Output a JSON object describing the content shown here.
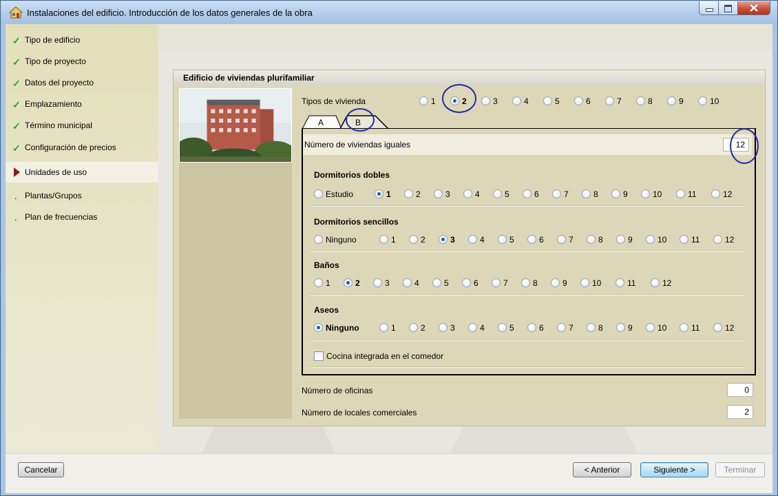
{
  "window": {
    "title": "Instalaciones del edificio. Introducción de los datos generales de la obra",
    "icon": "house-icon",
    "controls": [
      "minimize-icon",
      "maximize-icon",
      "close-icon"
    ]
  },
  "sidebar": {
    "items": [
      {
        "label": "Tipo de edificio",
        "state": "done"
      },
      {
        "label": "Tipo de proyecto",
        "state": "done"
      },
      {
        "label": "Datos del proyecto",
        "state": "done"
      },
      {
        "label": "Emplazamiento",
        "state": "done"
      },
      {
        "label": "Término municipal",
        "state": "done"
      },
      {
        "label": "Configuración de precios",
        "state": "done"
      },
      {
        "label": "Unidades de uso",
        "state": "current"
      },
      {
        "label": "Plantas/Grupos",
        "state": "pending"
      },
      {
        "label": "Plan de frecuencias",
        "state": "pending"
      }
    ]
  },
  "panel": {
    "title": "Edificio de viviendas plurifamiliar",
    "tipos_label": "Tipos de vivienda",
    "tipos_options": [
      "1",
      "2",
      "3",
      "4",
      "5",
      "6",
      "7",
      "8",
      "9",
      "10"
    ],
    "tipos_selected": "2",
    "tabs": [
      "A",
      "B"
    ],
    "active_tab": "B",
    "num_viviendas_label": "Número de viviendas iguales",
    "num_viviendas_value": "12",
    "dormitorios_dobles": {
      "title": "Dormitorios dobles",
      "options": [
        "Estudio",
        "1",
        "2",
        "3",
        "4",
        "5",
        "6",
        "7",
        "8",
        "9",
        "10",
        "11",
        "12"
      ],
      "selected": "1"
    },
    "dormitorios_sencillos": {
      "title": "Dormitorios sencillos",
      "options": [
        "Ninguno",
        "1",
        "2",
        "3",
        "4",
        "5",
        "6",
        "7",
        "8",
        "9",
        "10",
        "11",
        "12"
      ],
      "selected": "3"
    },
    "banos": {
      "title": "Baños",
      "options": [
        "1",
        "2",
        "3",
        "4",
        "5",
        "6",
        "7",
        "8",
        "9",
        "10",
        "11",
        "12"
      ],
      "selected": "2"
    },
    "aseos": {
      "title": "Aseos",
      "options": [
        "Ninguno",
        "1",
        "2",
        "3",
        "4",
        "5",
        "6",
        "7",
        "8",
        "9",
        "10",
        "11",
        "12"
      ],
      "selected": "Ninguno"
    },
    "cocina_label": "Cocina integrada en el comedor",
    "cocina_checked": false,
    "oficinas_label": "Número de oficinas",
    "oficinas_value": "0",
    "locales_label": "Número de locales comerciales",
    "locales_value": "2"
  },
  "footer": {
    "cancel": "Cancelar",
    "back": "< Anterior",
    "next": "Siguiente >",
    "finish": "Terminar"
  },
  "colors": {
    "sidebar": "#e3dfbb",
    "panel": "#dcd7b8",
    "annotation_circle": "#1f2aa6",
    "check": "#2f9d2f",
    "current_marker": "#8b1a1a"
  }
}
